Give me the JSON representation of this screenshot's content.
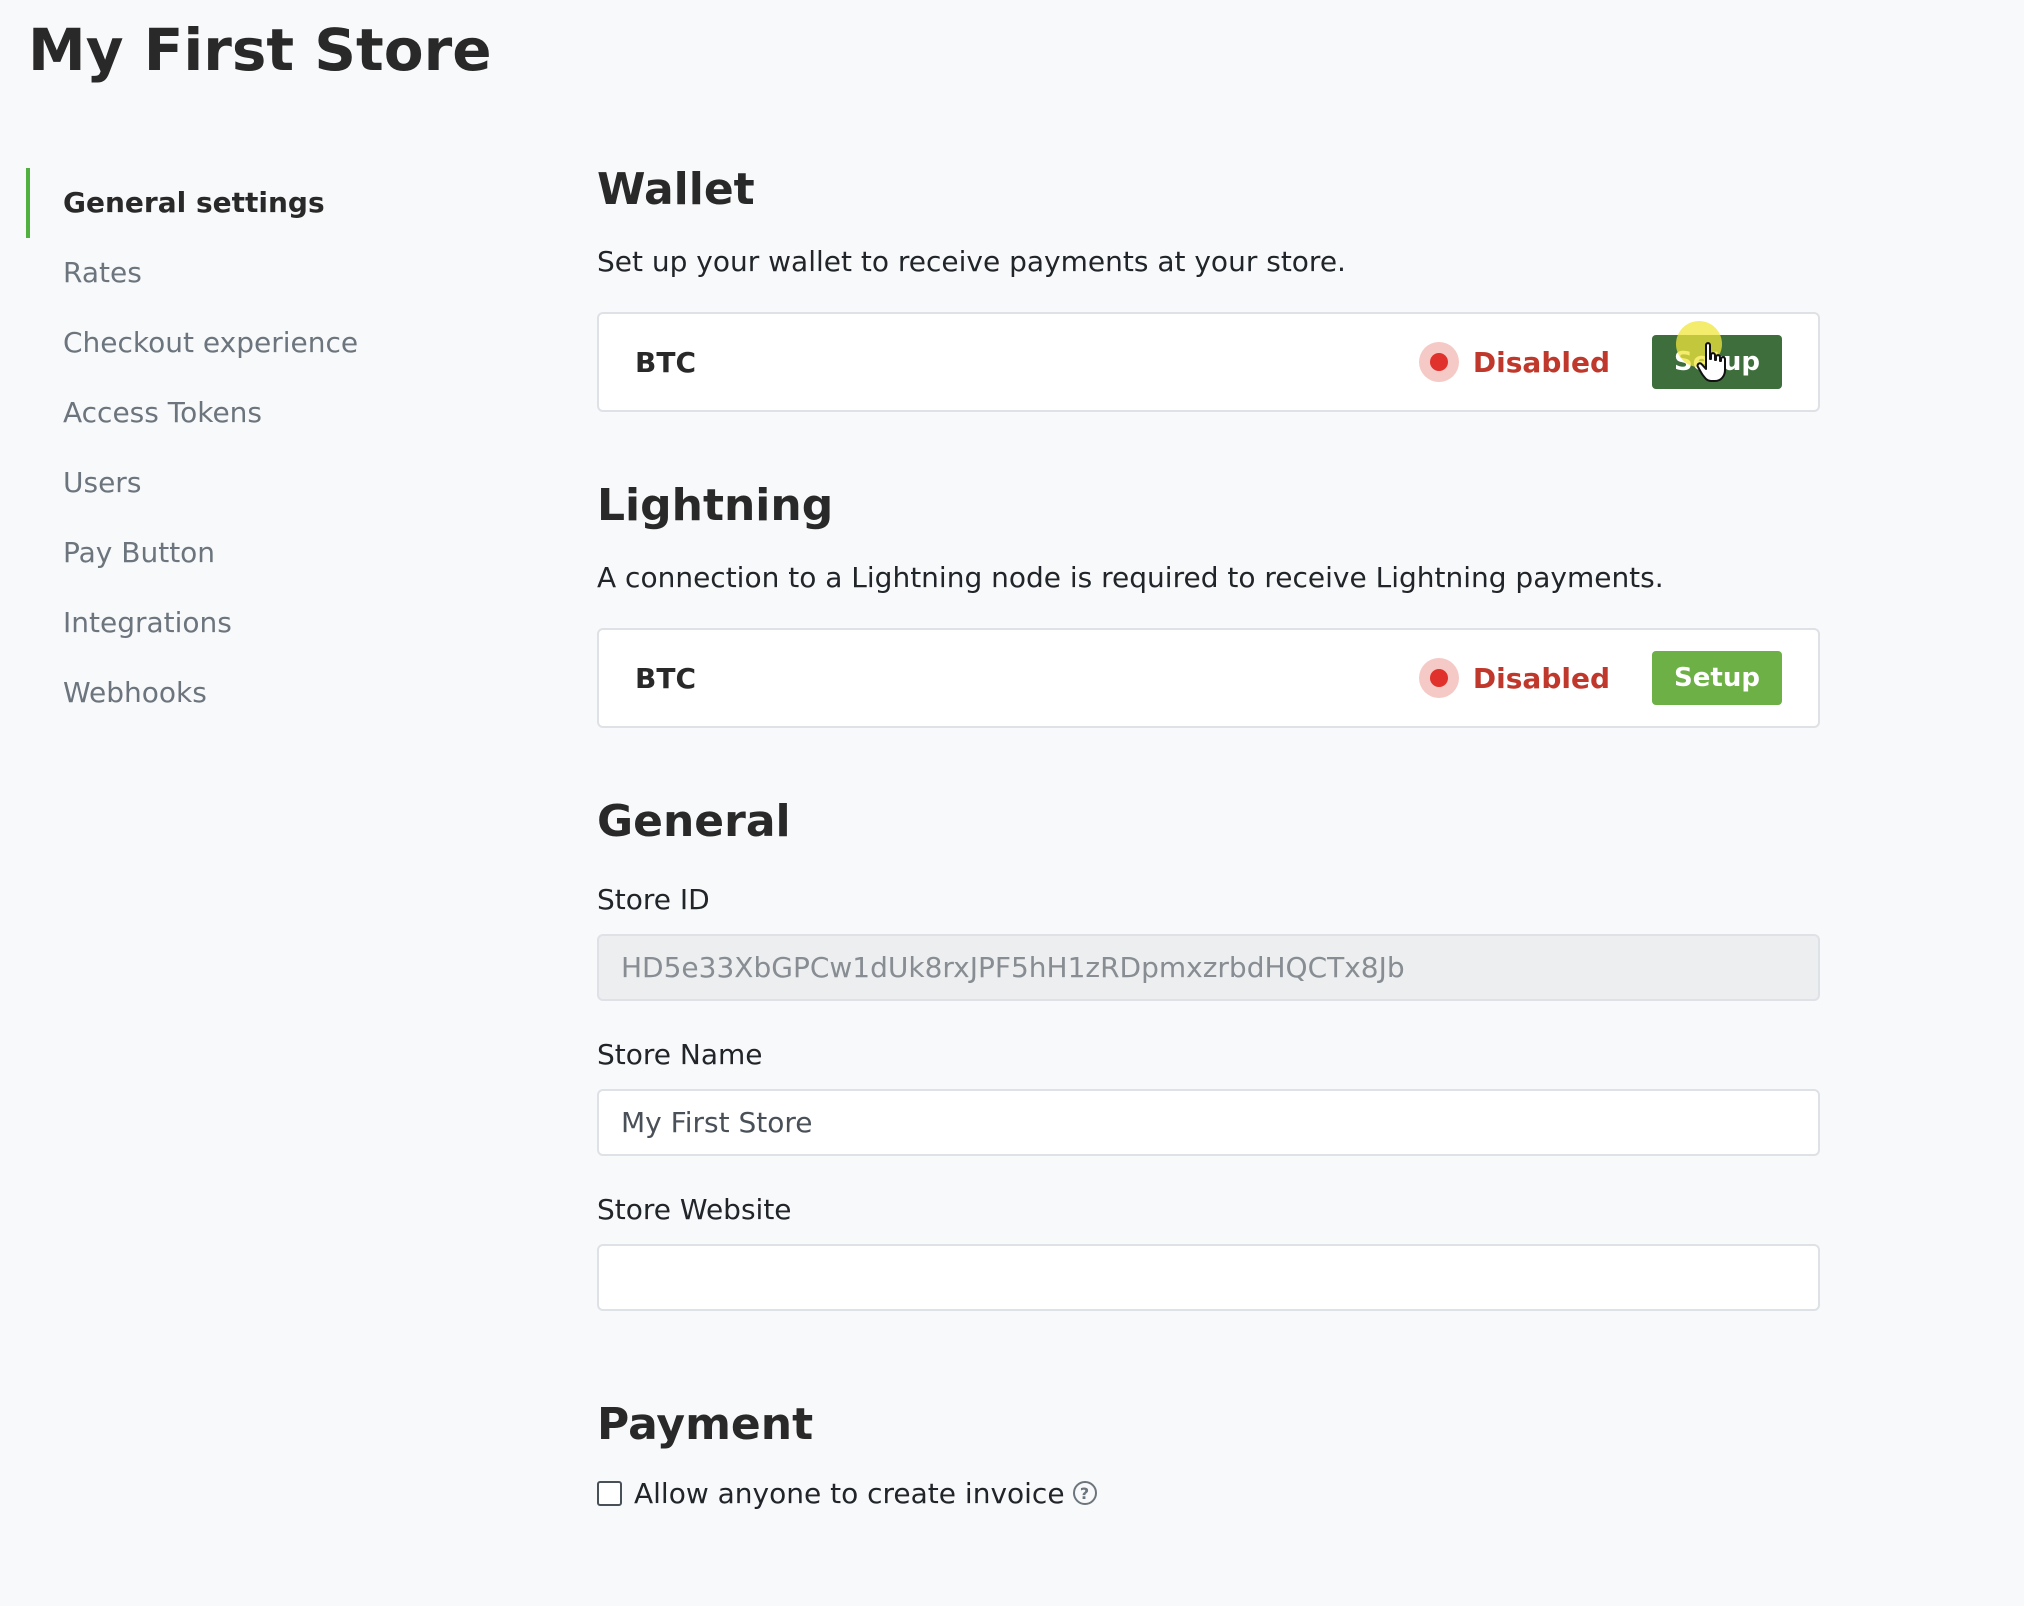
{
  "page": {
    "title": "My First Store"
  },
  "sidebar": {
    "items": [
      {
        "label": "General settings",
        "active": true
      },
      {
        "label": "Rates"
      },
      {
        "label": "Checkout experience"
      },
      {
        "label": "Access Tokens"
      },
      {
        "label": "Users"
      },
      {
        "label": "Pay Button"
      },
      {
        "label": "Integrations"
      },
      {
        "label": "Webhooks"
      }
    ]
  },
  "wallet": {
    "title": "Wallet",
    "description": "Set up your wallet to receive payments at your store.",
    "currency": "BTC",
    "status": "Disabled",
    "button": "Setup"
  },
  "lightning": {
    "title": "Lightning",
    "description": "A connection to a Lightning node is required to receive Lightning payments.",
    "currency": "BTC",
    "status": "Disabled",
    "button": "Setup"
  },
  "general": {
    "title": "General",
    "store_id_label": "Store ID",
    "store_id_value": "HD5e33XbGPCw1dUk8rxJPF5hH1zRDpmxzrbdHQCTx8Jb",
    "store_name_label": "Store Name",
    "store_name_value": "My First Store",
    "store_website_label": "Store Website",
    "store_website_value": ""
  },
  "payment": {
    "title": "Payment",
    "allow_invoice_label": "Allow anyone to create invoice",
    "help_glyph": "?"
  },
  "colors": {
    "accent": "#51b13e",
    "button": "#6cb046",
    "button_pressed": "#3d6e3c",
    "status_disabled": "#c0382b"
  }
}
